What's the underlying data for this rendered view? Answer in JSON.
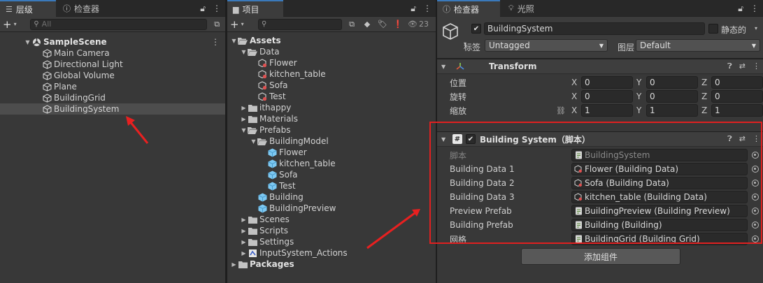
{
  "hierarchy": {
    "tab_label": "层级",
    "inspector_tab_label": "检查器",
    "search_placeholder": "All",
    "scene": "SampleScene",
    "items": [
      "Main Camera",
      "Directional Light",
      "Global Volume",
      "Plane",
      "BuildingGrid",
      "BuildingSystem"
    ],
    "selected": "BuildingSystem"
  },
  "project": {
    "tab_label": "项目",
    "hidden_count": "23",
    "tree": [
      {
        "label": "Assets",
        "depth": 0,
        "kind": "folder-open",
        "bold": true
      },
      {
        "label": "Data",
        "depth": 1,
        "kind": "folder-open"
      },
      {
        "label": "Flower",
        "depth": 2,
        "kind": "so"
      },
      {
        "label": "kitchen_table",
        "depth": 2,
        "kind": "so"
      },
      {
        "label": "Sofa",
        "depth": 2,
        "kind": "so"
      },
      {
        "label": "Test",
        "depth": 2,
        "kind": "so"
      },
      {
        "label": "ithappy",
        "depth": 1,
        "kind": "folder"
      },
      {
        "label": "Materials",
        "depth": 1,
        "kind": "folder"
      },
      {
        "label": "Prefabs",
        "depth": 1,
        "kind": "folder-open"
      },
      {
        "label": "BuildingModel",
        "depth": 2,
        "kind": "folder-open"
      },
      {
        "label": "Flower",
        "depth": 3,
        "kind": "prefab"
      },
      {
        "label": "kitchen_table",
        "depth": 3,
        "kind": "prefab"
      },
      {
        "label": "Sofa",
        "depth": 3,
        "kind": "prefab"
      },
      {
        "label": "Test",
        "depth": 3,
        "kind": "prefab"
      },
      {
        "label": "Building",
        "depth": 2,
        "kind": "prefab"
      },
      {
        "label": "BuildingPreview",
        "depth": 2,
        "kind": "prefab"
      },
      {
        "label": "Scenes",
        "depth": 1,
        "kind": "folder"
      },
      {
        "label": "Scripts",
        "depth": 1,
        "kind": "folder"
      },
      {
        "label": "Settings",
        "depth": 1,
        "kind": "folder"
      },
      {
        "label": "InputSystem_Actions",
        "depth": 1,
        "kind": "input"
      },
      {
        "label": "Packages",
        "depth": 0,
        "kind": "folder",
        "bold": true
      }
    ]
  },
  "inspector": {
    "tab_label": "检查器",
    "lighting_tab_label": "光照",
    "object_name": "BuildingSystem",
    "static_label": "静态的",
    "tag_label": "标签",
    "tag_value": "Untagged",
    "layer_label": "图层",
    "layer_value": "Default",
    "transform": {
      "title": "Transform",
      "position_label": "位置",
      "rotation_label": "旋转",
      "scale_label": "缩放",
      "axes": [
        "X",
        "Y",
        "Z"
      ],
      "position": [
        "0",
        "0",
        "0"
      ],
      "rotation": [
        "0",
        "0",
        "0"
      ],
      "scale": [
        "1",
        "1",
        "1"
      ]
    },
    "script_component": {
      "title": "Building System（脚本）",
      "rows": [
        {
          "label": "脚本",
          "value": "BuildingSystem",
          "icon": "script",
          "dim": true
        },
        {
          "label": "Building Data 1",
          "value": "Flower (Building Data)",
          "icon": "so"
        },
        {
          "label": "Building Data 2",
          "value": "Sofa (Building Data)",
          "icon": "so"
        },
        {
          "label": "Building Data 3",
          "value": "kitchen_table (Building Data)",
          "icon": "so"
        },
        {
          "label": "Preview Prefab",
          "value": "BuildingPreview (Building Preview)",
          "icon": "script"
        },
        {
          "label": "Building Prefab",
          "value": "Building (Building)",
          "icon": "script"
        },
        {
          "label": "网格",
          "value": "BuildingGrid (Building Grid)",
          "icon": "script"
        }
      ]
    },
    "add_component_label": "添加组件"
  },
  "colors": {
    "accent": "#3a79bb",
    "annotation_red": "#e02020",
    "prefab_blue": "#7cc8f2"
  }
}
